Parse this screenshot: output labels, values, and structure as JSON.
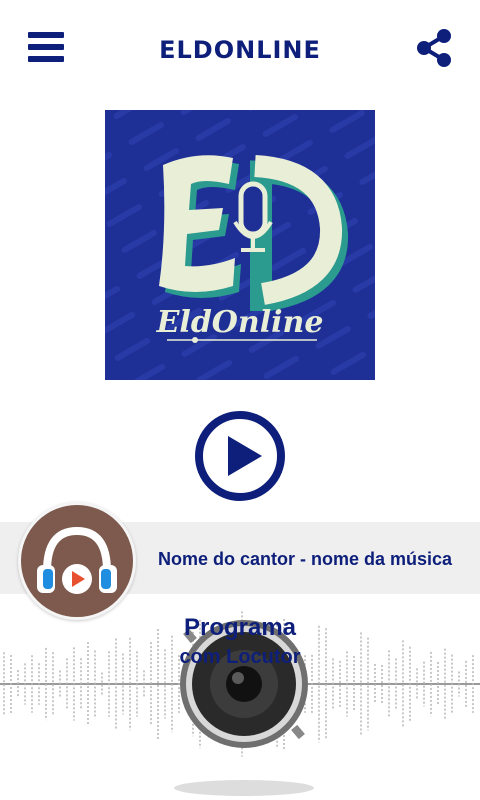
{
  "header": {
    "title": "ELDONLINE",
    "menu_icon": "hamburger-menu-icon",
    "share_icon": "share-icon"
  },
  "cover": {
    "logo_text": "EldOnline",
    "logo_monogram": "ED"
  },
  "player": {
    "play_icon": "play-icon",
    "now_playing": "Nome do cantor - nome da música",
    "avatar_icon": "headphones-play-icon"
  },
  "program": {
    "name": "Programa",
    "presenter": "com Locutor"
  },
  "colors": {
    "primary": "#0d1f7a",
    "cover_bg": "#1e2f96",
    "avatar_bg": "#7d5a4d",
    "bar_bg": "#efefef"
  }
}
